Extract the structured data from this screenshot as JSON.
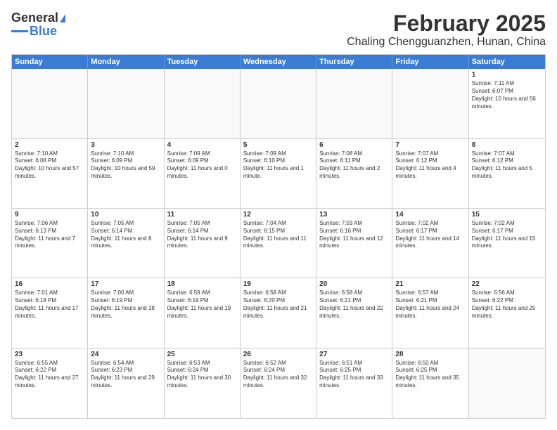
{
  "header": {
    "logo_general": "General",
    "logo_blue": "Blue",
    "title": "February 2025",
    "subtitle": "Chaling Chengguanzhen, Hunan, China"
  },
  "weekdays": [
    "Sunday",
    "Monday",
    "Tuesday",
    "Wednesday",
    "Thursday",
    "Friday",
    "Saturday"
  ],
  "rows": [
    [
      {
        "day": "",
        "text": ""
      },
      {
        "day": "",
        "text": ""
      },
      {
        "day": "",
        "text": ""
      },
      {
        "day": "",
        "text": ""
      },
      {
        "day": "",
        "text": ""
      },
      {
        "day": "",
        "text": ""
      },
      {
        "day": "1",
        "text": "Sunrise: 7:11 AM\nSunset: 6:07 PM\nDaylight: 10 hours and 56 minutes."
      }
    ],
    [
      {
        "day": "2",
        "text": "Sunrise: 7:10 AM\nSunset: 6:08 PM\nDaylight: 10 hours and 57 minutes."
      },
      {
        "day": "3",
        "text": "Sunrise: 7:10 AM\nSunset: 6:09 PM\nDaylight: 10 hours and 59 minutes."
      },
      {
        "day": "4",
        "text": "Sunrise: 7:09 AM\nSunset: 6:09 PM\nDaylight: 11 hours and 0 minutes."
      },
      {
        "day": "5",
        "text": "Sunrise: 7:09 AM\nSunset: 6:10 PM\nDaylight: 11 hours and 1 minute."
      },
      {
        "day": "6",
        "text": "Sunrise: 7:08 AM\nSunset: 6:11 PM\nDaylight: 11 hours and 2 minutes."
      },
      {
        "day": "7",
        "text": "Sunrise: 7:07 AM\nSunset: 6:12 PM\nDaylight: 11 hours and 4 minutes."
      },
      {
        "day": "8",
        "text": "Sunrise: 7:07 AM\nSunset: 6:12 PM\nDaylight: 11 hours and 5 minutes."
      }
    ],
    [
      {
        "day": "9",
        "text": "Sunrise: 7:06 AM\nSunset: 6:13 PM\nDaylight: 11 hours and 7 minutes."
      },
      {
        "day": "10",
        "text": "Sunrise: 7:05 AM\nSunset: 6:14 PM\nDaylight: 11 hours and 8 minutes."
      },
      {
        "day": "11",
        "text": "Sunrise: 7:05 AM\nSunset: 6:14 PM\nDaylight: 11 hours and 9 minutes."
      },
      {
        "day": "12",
        "text": "Sunrise: 7:04 AM\nSunset: 6:15 PM\nDaylight: 11 hours and 11 minutes."
      },
      {
        "day": "13",
        "text": "Sunrise: 7:03 AM\nSunset: 6:16 PM\nDaylight: 11 hours and 12 minutes."
      },
      {
        "day": "14",
        "text": "Sunrise: 7:02 AM\nSunset: 6:17 PM\nDaylight: 11 hours and 14 minutes."
      },
      {
        "day": "15",
        "text": "Sunrise: 7:02 AM\nSunset: 6:17 PM\nDaylight: 11 hours and 15 minutes."
      }
    ],
    [
      {
        "day": "16",
        "text": "Sunrise: 7:01 AM\nSunset: 6:18 PM\nDaylight: 11 hours and 17 minutes."
      },
      {
        "day": "17",
        "text": "Sunrise: 7:00 AM\nSunset: 6:19 PM\nDaylight: 11 hours and 18 minutes."
      },
      {
        "day": "18",
        "text": "Sunrise: 6:59 AM\nSunset: 6:19 PM\nDaylight: 11 hours and 19 minutes."
      },
      {
        "day": "19",
        "text": "Sunrise: 6:58 AM\nSunset: 6:20 PM\nDaylight: 11 hours and 21 minutes."
      },
      {
        "day": "20",
        "text": "Sunrise: 6:58 AM\nSunset: 6:21 PM\nDaylight: 11 hours and 22 minutes."
      },
      {
        "day": "21",
        "text": "Sunrise: 6:57 AM\nSunset: 6:21 PM\nDaylight: 11 hours and 24 minutes."
      },
      {
        "day": "22",
        "text": "Sunrise: 6:56 AM\nSunset: 6:22 PM\nDaylight: 11 hours and 25 minutes."
      }
    ],
    [
      {
        "day": "23",
        "text": "Sunrise: 6:55 AM\nSunset: 6:22 PM\nDaylight: 11 hours and 27 minutes."
      },
      {
        "day": "24",
        "text": "Sunrise: 6:54 AM\nSunset: 6:23 PM\nDaylight: 11 hours and 29 minutes."
      },
      {
        "day": "25",
        "text": "Sunrise: 6:53 AM\nSunset: 6:24 PM\nDaylight: 11 hours and 30 minutes."
      },
      {
        "day": "26",
        "text": "Sunrise: 6:52 AM\nSunset: 6:24 PM\nDaylight: 11 hours and 32 minutes."
      },
      {
        "day": "27",
        "text": "Sunrise: 6:51 AM\nSunset: 6:25 PM\nDaylight: 11 hours and 33 minutes."
      },
      {
        "day": "28",
        "text": "Sunrise: 6:50 AM\nSunset: 6:25 PM\nDaylight: 11 hours and 35 minutes."
      },
      {
        "day": "",
        "text": ""
      }
    ]
  ]
}
